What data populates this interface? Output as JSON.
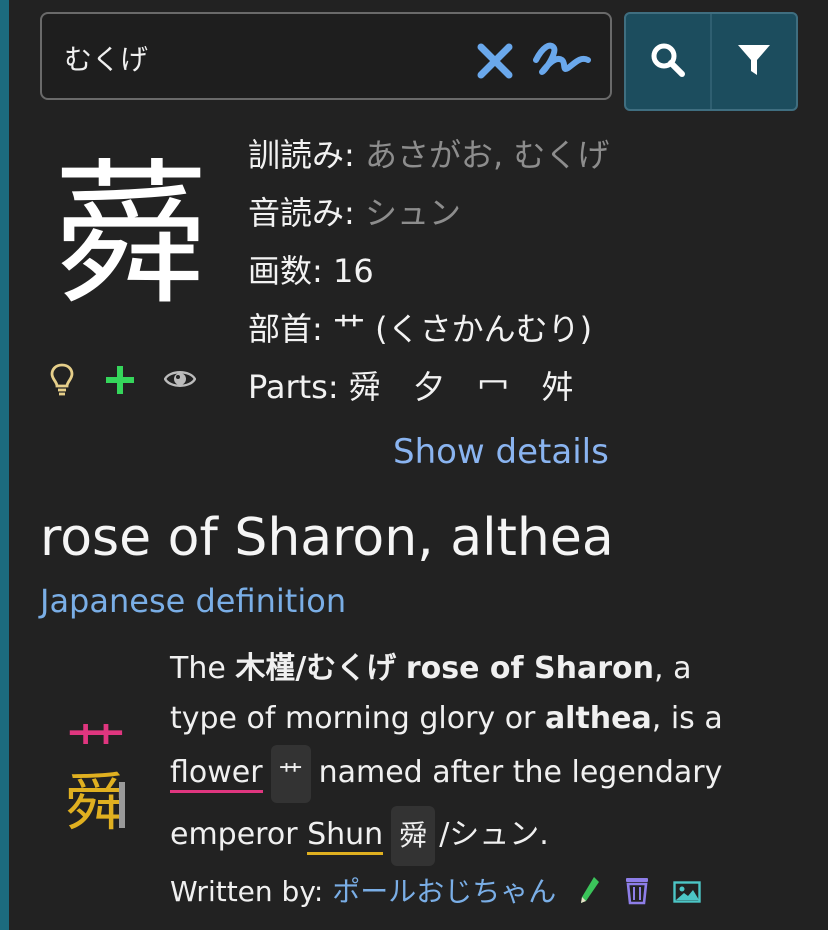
{
  "search": {
    "query": "むくげ"
  },
  "kanji": {
    "character": "蕣",
    "kun_label": "訓読み:",
    "kun_value": "あさがお, むくげ",
    "on_label": "音読み:",
    "on_value": "シュン",
    "strokes_label": "画数:",
    "strokes_value": "16",
    "radical_label": "部首:",
    "radical_value": "艹 (くさかんむり)",
    "parts_label": "Parts:",
    "parts": [
      "舜",
      "夕",
      "冖",
      "舛"
    ],
    "show_details": "Show details",
    "meaning": "rose of Sharon, althea",
    "jp_definition_link": "Japanese definition"
  },
  "mnemonic": {
    "the": "The",
    "word_jp": "木槿/むくげ",
    "rose": "rose of Sharon",
    "comma_a": ", a",
    "line2_text": "type of morning glory or",
    "althea": "althea",
    "is_a": ", is a",
    "flower": "flower",
    "flower_chip": "艹",
    "named_after": "named after the legendary",
    "emperor": "emperor",
    "shun": "Shun",
    "shun_chip": "舜",
    "shun_reading": "/シュン.",
    "written_by_label": "Written by:",
    "author": "ポールおじちゃん",
    "art_top": "艹",
    "art_bottom": "舜"
  },
  "icons": {
    "clear": "close-icon",
    "handwriting": "handwriting-icon",
    "search": "search-icon",
    "filter": "filter-icon",
    "hint": "lightbulb-icon",
    "add": "plus-icon",
    "view": "eye-icon",
    "edit": "pencil-icon",
    "delete": "trash-icon",
    "image": "image-icon"
  },
  "colors": {
    "accent_blue": "#8ab4f0",
    "search_button_bg": "#1c4d5e",
    "clear_blue": "#6aa8ec",
    "plus_green": "#35d65b",
    "pink": "#e0367f",
    "yellow": "#e0b020"
  }
}
